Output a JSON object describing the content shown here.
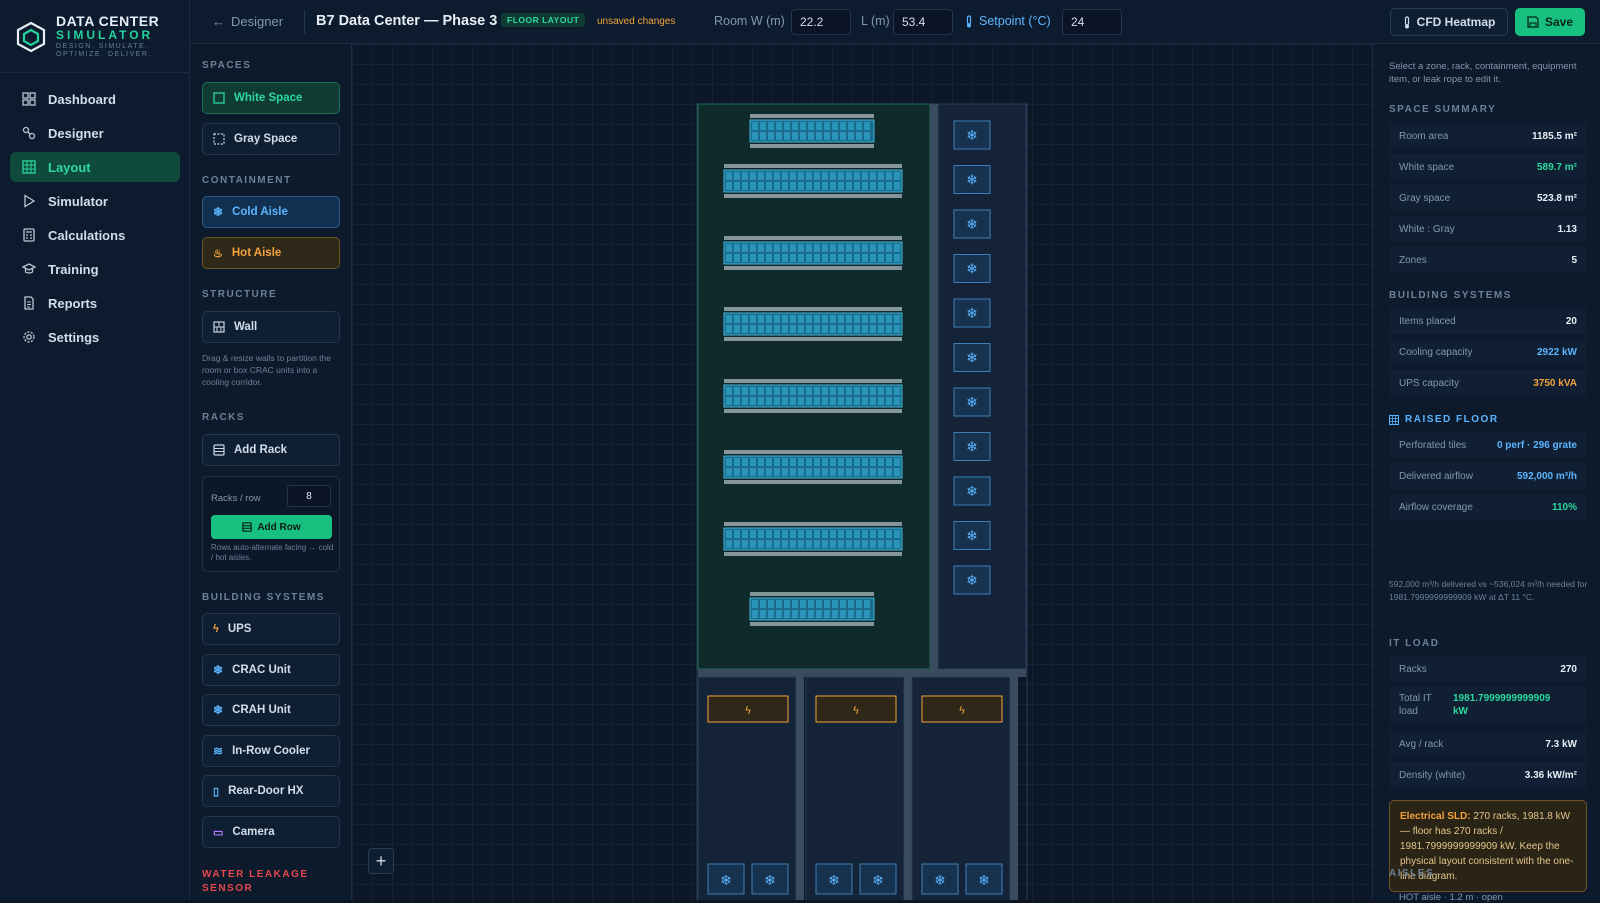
{
  "app": {
    "title_line1": "DATA CENTER",
    "title_line2": "SIMULATOR",
    "tagline": "DESIGN. SIMULATE. OPTIMIZE. DELIVER."
  },
  "nav": [
    {
      "label": "Dashboard",
      "icon": "dashboard-icon"
    },
    {
      "label": "Designer",
      "icon": "designer-icon"
    },
    {
      "label": "Layout",
      "icon": "layout-icon",
      "active": true
    },
    {
      "label": "Simulator",
      "icon": "play-icon"
    },
    {
      "label": "Calculations",
      "icon": "calculator-icon"
    },
    {
      "label": "Training",
      "icon": "graduation-cap-icon"
    },
    {
      "label": "Reports",
      "icon": "report-icon"
    },
    {
      "label": "Settings",
      "icon": "gear-icon"
    }
  ],
  "header": {
    "back_label": "Designer",
    "page_title": "B7 Data Center — Phase 3",
    "badge": "FLOOR LAYOUT",
    "unsaved": "unsaved changes",
    "room_w_label": "Room W (m)",
    "room_w": "22.2",
    "room_l_label": "L (m)",
    "room_l": "53.4",
    "setpoint_label": "Setpoint (°C)",
    "setpoint": "24",
    "cfd_label": "CFD Heatmap",
    "save_label": "Save"
  },
  "palette": {
    "spaces_title": "SPACES",
    "white_space": "White Space",
    "gray_space": "Gray Space",
    "containment_title": "CONTAINMENT",
    "cold_aisle": "Cold Aisle",
    "hot_aisle": "Hot Aisle",
    "structure_title": "STRUCTURE",
    "wall": "Wall",
    "wall_note": "Drag & resize walls to partition the room or box CRAC units into a cooling corridor.",
    "racks_title": "RACKS",
    "add_rack": "Add Rack",
    "racks_per_row_label": "Racks / row",
    "racks_per_row": "8",
    "add_row": "Add Row",
    "row_note": "Rows auto-alternate facing → cold / hot aisles.",
    "building_title": "BUILDING SYSTEMS",
    "ups": "UPS",
    "crac": "CRAC Unit",
    "crah": "CRAH Unit",
    "inrow": "In-Row Cooler",
    "reardoor": "Rear-Door HX",
    "camera": "Camera",
    "sensor_title": "WATER LEAKAGE SENSOR"
  },
  "right": {
    "hint": "Select a zone, rack, containment, equipment item, or leak rope to edit it.",
    "space_title": "SPACE SUMMARY",
    "space": [
      {
        "k": "Room area",
        "v": "1185.5 m²",
        "c": ""
      },
      {
        "k": "White space",
        "v": "589.7 m²",
        "c": "g"
      },
      {
        "k": "Gray space",
        "v": "523.8 m²",
        "c": ""
      },
      {
        "k": "White : Gray",
        "v": "1.13",
        "c": ""
      },
      {
        "k": "Zones",
        "v": "5",
        "c": ""
      }
    ],
    "bs_title": "BUILDING SYSTEMS",
    "bs": [
      {
        "k": "Items placed",
        "v": "20",
        "c": ""
      },
      {
        "k": "Cooling capacity",
        "v": "2922 kW",
        "c": "b"
      },
      {
        "k": "UPS capacity",
        "v": "3750 kVA",
        "c": "o"
      }
    ],
    "rf_title": "RAISED FLOOR",
    "rf": [
      {
        "k": "Perforated tiles",
        "v": "0 perf · 296 grate",
        "c": "b"
      },
      {
        "k": "Delivered airflow",
        "v": "592,000 m³/h",
        "c": "b"
      },
      {
        "k": "Airflow coverage",
        "v": "110%",
        "c": "g"
      }
    ],
    "rf_note": "592,000 m³/h delivered vs ~536,024 m³/h needed for 1981.7999999999909 kW at ΔT 11 °C.",
    "it_title": "IT LOAD",
    "it_racks": {
      "k": "Racks",
      "v": "270"
    },
    "it_total": {
      "k1": "Total IT",
      "k2": "load",
      "v1": "1981.7999999999909",
      "v2": "kW"
    },
    "it_avg": {
      "k": "Avg / rack",
      "v": "7.3 kW"
    },
    "it_density": {
      "k": "Density (white)",
      "v": "3.36 kW/m²"
    },
    "alert_bold": "Electrical SLD:",
    "alert_text": " 270 racks, 1981.8 kW — floor has 270 racks / 1981.7999999999909 kW. Keep the physical layout consistent with the one-line diagram.",
    "aisles_title": "AISLES",
    "aisle_first": "HOT aisle · 1.2 m · open"
  },
  "colors": {
    "accent": "#18c07f",
    "blue": "#5cb6ff",
    "orange": "#f4a23c",
    "bg": "#0b1626"
  }
}
